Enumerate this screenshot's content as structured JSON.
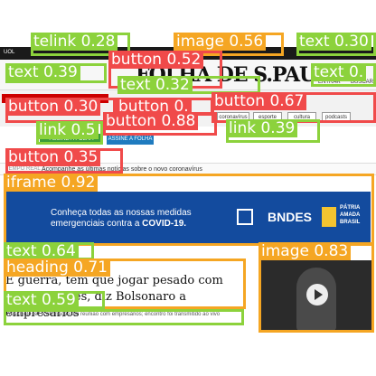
{
  "site": {
    "logo": "FOLHA DE S.PAULO",
    "topbar_left": "UOL",
    "nav_left": [
      "MENU",
      "ASSINE"
    ],
    "nav_right": [
      "ENTRAR",
      "BUSCAR"
    ],
    "subscribe_label": "ASSINE A FOLHA",
    "sections": [
      "coronavírus",
      "esporte",
      "cultura",
      "podcasts"
    ]
  },
  "news_bar": {
    "label": "TEMPO REAL",
    "text": "Acompanhe as últimas notícias sobre o novo coronavírus"
  },
  "ad_banner": {
    "line1": "Conheça todas as nossas medidas",
    "line2": "emergenciais contra a ",
    "line2_bold": "COVID-19.",
    "brand": "BNDES",
    "partner": "PÁTRIA AMADA BRASIL"
  },
  "article": {
    "headline": "É guerra, tem que jogar pesado com governadores, diz Bolsonaro a empresários",
    "caption": "Presidente fez a afirmação em reunião com empresários; encontro foi transmitido ao vivo"
  },
  "overlays": [
    {
      "label": "telink 0.28",
      "color": "#8cd23c"
    },
    {
      "label": "image 0.56",
      "color": "#f5a623"
    },
    {
      "label": "text 0.30",
      "color": "#8cd23c"
    },
    {
      "label": "text 0.39",
      "color": "#8cd23c"
    },
    {
      "label": "button 0.52",
      "color": "#f04a4a"
    },
    {
      "label": "text 0.32",
      "color": "#8cd23c"
    },
    {
      "label": "text 0.",
      "color": "#8cd23c"
    },
    {
      "label": "button 0.30",
      "color": "#f04a4a"
    },
    {
      "label": "button 0.",
      "color": "#f04a4a"
    },
    {
      "label": "button 0.88",
      "color": "#f04a4a"
    },
    {
      "label": "button 0.67",
      "color": "#f04a4a"
    },
    {
      "label": "link 0.5",
      "color": "#8cd23c"
    },
    {
      "label": "link 0.39",
      "color": "#8cd23c"
    },
    {
      "label": "button 0.35",
      "color": "#f04a4a"
    },
    {
      "label": "iframe 0.92",
      "color": "#f5a623"
    },
    {
      "label": "text 0.64",
      "color": "#8cd23c"
    },
    {
      "label": "image 0.83",
      "color": "#f5a623"
    },
    {
      "label": "heading 0.71",
      "color": "#f5a623"
    },
    {
      "label": "text 0.59",
      "color": "#8cd23c"
    }
  ]
}
